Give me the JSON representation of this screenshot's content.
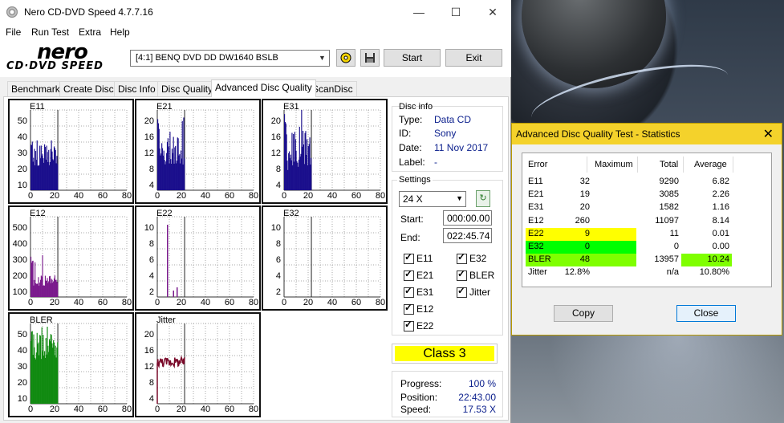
{
  "window": {
    "title": "Nero CD-DVD Speed 4.7.7.16",
    "minimize": "—",
    "maximize": "☐",
    "close": "✕"
  },
  "menu": [
    "File",
    "Run Test",
    "Extra",
    "Help"
  ],
  "logo": {
    "brand": "nero",
    "product": "CD·DVD SPEED"
  },
  "toolbar": {
    "drive": "[4:1]   BENQ DVD DD DW1640 BSLB",
    "start": "Start",
    "exit": "Exit"
  },
  "tabs": [
    "Benchmark",
    "Create Disc",
    "Disc Info",
    "Disc Quality",
    "Advanced Disc Quality",
    "ScanDisc"
  ],
  "active_tab": "Advanced Disc Quality",
  "disc_info": {
    "title": "Disc info",
    "type_label": "Type:",
    "type": "Data CD",
    "id_label": "ID:",
    "id": "Sony",
    "date_label": "Date:",
    "date": "11 Nov 2017",
    "label_label": "Label:",
    "label": "-"
  },
  "settings": {
    "title": "Settings",
    "speed": "24 X",
    "start_label": "Start:",
    "start": "000:00.00",
    "end_label": "End:",
    "end": "022:45.74",
    "checks": {
      "e11": "E11",
      "e32": "E32",
      "e21": "E21",
      "bler": "BLER",
      "e31": "E31",
      "jitter": "Jitter",
      "e12": "E12",
      "e22": "E22"
    }
  },
  "class_result": "Class 3",
  "progress": {
    "progress_label": "Progress:",
    "progress": "100 %",
    "position_label": "Position:",
    "position": "22:43.00",
    "speed_label": "Speed:",
    "speed": "17.53 X"
  },
  "graphs": {
    "x_ticks": [
      "0",
      "20",
      "40",
      "60",
      "80"
    ],
    "e11": {
      "label": "E11",
      "y_ticks": [
        "50",
        "40",
        "30",
        "20",
        "10"
      ]
    },
    "e21": {
      "label": "E21",
      "y_ticks": [
        "20",
        "16",
        "12",
        "8",
        "4"
      ]
    },
    "e31": {
      "label": "E31",
      "y_ticks": [
        "20",
        "16",
        "12",
        "8",
        "4"
      ]
    },
    "e12": {
      "label": "E12",
      "y_ticks": [
        "500",
        "400",
        "300",
        "200",
        "100"
      ]
    },
    "e22": {
      "label": "E22",
      "y_ticks": [
        "10",
        "8",
        "6",
        "4",
        "2"
      ]
    },
    "e32": {
      "label": "E32",
      "y_ticks": [
        "10",
        "8",
        "6",
        "4",
        "2"
      ]
    },
    "bler": {
      "label": "BLER",
      "y_ticks": [
        "50",
        "40",
        "30",
        "20",
        "10"
      ]
    },
    "jitter": {
      "label": "Jitter",
      "y_ticks": [
        "20",
        "16",
        "12",
        "8",
        "4"
      ]
    }
  },
  "colors": {
    "e11": "#1a0f8c",
    "e12": "#7a1a8c",
    "bler": "#118a11",
    "jitter": "#7a0a2a",
    "dialog_title": "#f4d22b"
  },
  "stats_dialog": {
    "title": "Advanced Disc Quality Test - Statistics",
    "close": "✕",
    "headers": {
      "error": "Error",
      "maximum": "Maximum",
      "total": "Total",
      "average": "Average"
    },
    "rows": [
      {
        "error": "E11",
        "maximum": "32",
        "total": "9290",
        "average": "6.82"
      },
      {
        "error": "E21",
        "maximum": "19",
        "total": "3085",
        "average": "2.26"
      },
      {
        "error": "E31",
        "maximum": "20",
        "total": "1582",
        "average": "1.16"
      },
      {
        "error": "E12",
        "maximum": "260",
        "total": "11097",
        "average": "8.14"
      },
      {
        "error": "E22",
        "maximum": "9",
        "total": "11",
        "average": "0.01"
      },
      {
        "error": "E32",
        "maximum": "0",
        "total": "0",
        "average": "0.00"
      },
      {
        "error": "BLER",
        "maximum": "48",
        "total": "13957",
        "average": "10.24"
      },
      {
        "error": "Jitter",
        "maximum": "12.8%",
        "total": "n/a",
        "average": "10.80%"
      }
    ],
    "copy": "Copy",
    "close_button": "Close"
  }
}
